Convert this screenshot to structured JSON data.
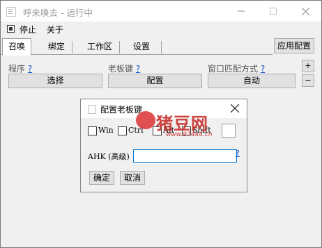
{
  "window": {
    "title": "呼来唤去 - 运行中"
  },
  "menu": {
    "items": [
      "停止",
      "关于"
    ]
  },
  "tabs": [
    "召唤",
    "绑定",
    "工作区",
    "设置"
  ],
  "apply_button": "应用配置",
  "fields": {
    "program": {
      "label": "程序",
      "help": "?",
      "button": "选择"
    },
    "boss_key": {
      "label": "老板键",
      "help": "?",
      "button": "配置"
    },
    "window_match": {
      "label": "窗口匹配方式",
      "help": "?",
      "button": "自动"
    }
  },
  "side_buttons": {
    "add": "+",
    "remove": "−"
  },
  "dialog": {
    "title": "配置老板键",
    "modifiers": [
      "Win",
      "Ctrl",
      "Alt",
      "Shift"
    ],
    "ahk_label": "AHK (高级)",
    "ahk_value": "",
    "ahk_help": "?",
    "ok": "确定",
    "cancel": "取消"
  },
  "watermark": {
    "text": "猪豆网",
    "url": "www.97444.cn",
    "color": "#c8302c"
  }
}
